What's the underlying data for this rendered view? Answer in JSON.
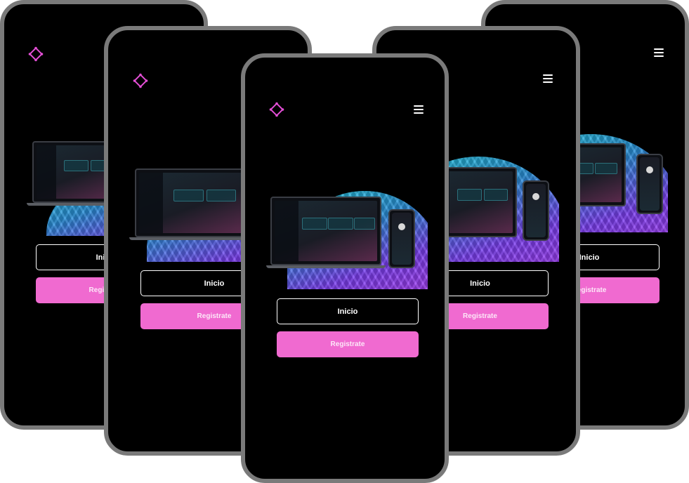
{
  "colors": {
    "background": "#ffffff",
    "phone_bg": "#000000",
    "phone_border": "#7a7a7a",
    "accent": "#f06ad0",
    "logo": "#e44fd6"
  },
  "icons": {
    "logo": "diamond-logo-icon",
    "menu": "hamburger-menu-icon"
  },
  "phones": [
    {
      "id": "far-left",
      "login_label": "Inicio",
      "register_label": "Registrate"
    },
    {
      "id": "mid-left",
      "login_label": "Inicio",
      "register_label": "Registrate"
    },
    {
      "id": "center",
      "login_label": "Inicio",
      "register_label": "Registrate"
    },
    {
      "id": "mid-right",
      "login_label": "Inicio",
      "register_label": "Registrate"
    },
    {
      "id": "far-right",
      "login_label": "Inicio",
      "register_label": "Registrate"
    }
  ]
}
